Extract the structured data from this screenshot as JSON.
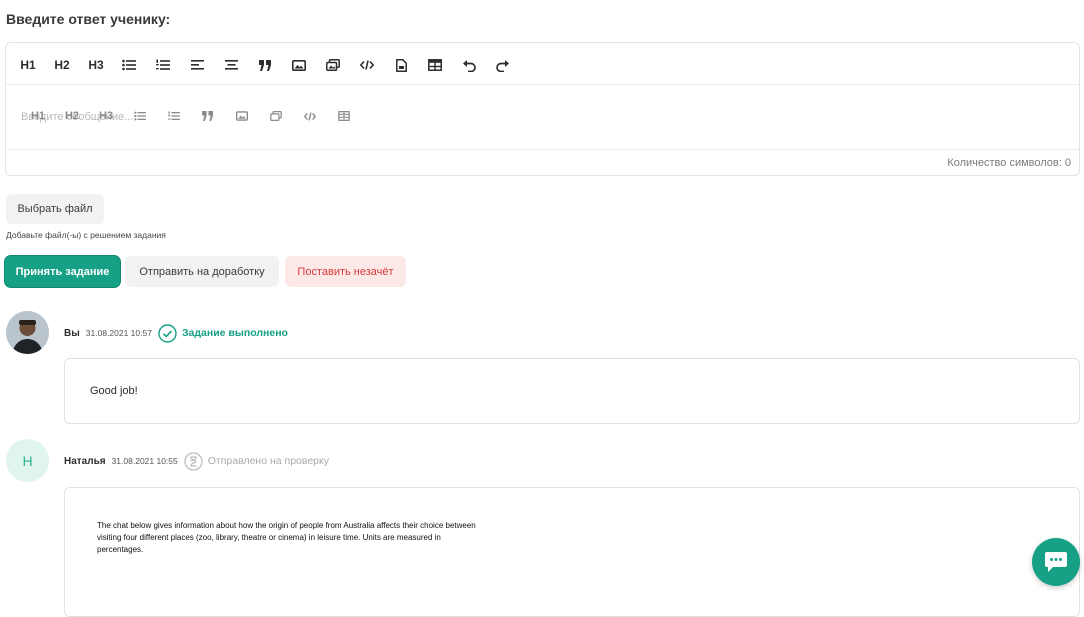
{
  "heading": "Введите ответ ученику:",
  "editor": {
    "toolbar": {
      "h1": "H1",
      "h2": "H2",
      "h3": "H3",
      "icons": [
        "bullet-list-icon",
        "numbered-list-icon",
        "align-left-icon",
        "align-center-icon",
        "quote-icon",
        "image-icon",
        "gallery-icon",
        "code-icon",
        "file-icon",
        "table-icon",
        "undo-icon",
        "redo-icon"
      ]
    },
    "inline_toolbar": {
      "h1": "H1",
      "h2": "H2",
      "h3": "H3"
    },
    "placeholder": "Введите сообщение...",
    "char_count": "Количество символов: 0"
  },
  "file": {
    "button": "Выбрать файл",
    "hint": "Добавьте файл(-ы) с решением задания"
  },
  "actions": {
    "accept": "Принять задание",
    "return": "Отправить на доработку",
    "fail": "Поставить незачёт"
  },
  "colors": {
    "accent": "#16a085",
    "danger": "#d83a3a",
    "danger_bg": "#fde8e8"
  },
  "messages": [
    {
      "author": "Вы",
      "time": "31.08.2021 10:57",
      "status": "Задание выполнено",
      "text": "Good job!"
    },
    {
      "author": "Наталья",
      "avatar_letter": "Н",
      "time": "31.08.2021 10:55",
      "status": "Отправлено на проверку",
      "text": "The chat below gives information about how the origin of people from Australia affects their choice between visiting four different places (zoo, library, theatre or cinema) in leisure time. Units are measured in percentages."
    }
  ]
}
